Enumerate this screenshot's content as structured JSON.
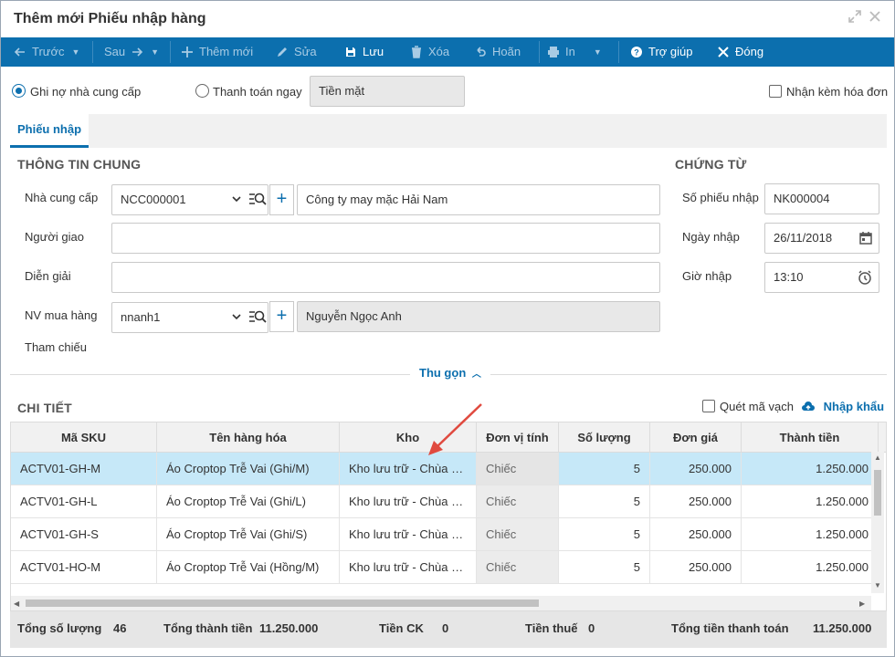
{
  "window": {
    "title": "Thêm mới Phiếu nhập hàng"
  },
  "toolbar": {
    "prev": "Trước",
    "next": "Sau",
    "add": "Thêm mới",
    "edit": "Sửa",
    "save": "Lưu",
    "delete": "Xóa",
    "undo": "Hoãn",
    "print": "In",
    "help": "Trợ giúp",
    "close": "Đóng"
  },
  "payment": {
    "debt_label": "Ghi nợ nhà cung cấp",
    "pay_now_label": "Thanh toán ngay",
    "method_value": "Tiền mặt",
    "invoice_label": "Nhận kèm hóa đơn"
  },
  "tabs": [
    {
      "label": "Phiếu nhập"
    }
  ],
  "general": {
    "heading": "THÔNG TIN CHUNG",
    "supplier_label": "Nhà cung cấp",
    "supplier_code": "NCC000001",
    "supplier_name": "Công ty may mặc Hải Nam",
    "deliverer_label": "Người giao",
    "deliverer_value": "",
    "description_label": "Diễn giải",
    "description_value": "",
    "buyer_label": "NV mua hàng",
    "buyer_code": "nnanh1",
    "buyer_name": "Nguyễn Ngọc Anh",
    "reference_label": "Tham chiếu"
  },
  "voucher": {
    "heading": "CHỨNG TỪ",
    "number_label": "Số phiếu nhập",
    "number_value": "NK000004",
    "date_label": "Ngày nhập",
    "date_value": "26/11/2018",
    "time_label": "Giờ nhập",
    "time_value": "13:10"
  },
  "collapse_label": "Thu gọn",
  "detail": {
    "heading": "CHI TIẾT",
    "barcode_label": "Quét mã vạch",
    "import_label": "Nhập khẩu",
    "columns": [
      "Mã SKU",
      "Tên hàng hóa",
      "Kho",
      "Đơn vị tính",
      "Số lượng",
      "Đơn giá",
      "Thành tiền"
    ],
    "rows": [
      {
        "sku": "ACTV01-GH-M",
        "name": "Áo Croptop Trễ Vai (Ghi/M)",
        "warehouse": "Kho lưu trữ - Chùa Bộc",
        "unit": "Chiếc",
        "qty": "5",
        "price": "250.000",
        "amount": "1.250.000"
      },
      {
        "sku": "ACTV01-GH-L",
        "name": "Áo Croptop Trễ Vai (Ghi/L)",
        "warehouse": "Kho lưu trữ - Chùa Bộc",
        "unit": "Chiếc",
        "qty": "5",
        "price": "250.000",
        "amount": "1.250.000"
      },
      {
        "sku": "ACTV01-GH-S",
        "name": "Áo Croptop Trễ Vai (Ghi/S)",
        "warehouse": "Kho lưu trữ - Chùa Bộc",
        "unit": "Chiếc",
        "qty": "5",
        "price": "250.000",
        "amount": "1.250.000"
      },
      {
        "sku": "ACTV01-HO-M",
        "name": "Áo Croptop Trễ Vai (Hồng/M)",
        "warehouse": "Kho lưu trữ - Chùa Bộc",
        "unit": "Chiếc",
        "qty": "5",
        "price": "250.000",
        "amount": "1.250.000"
      }
    ]
  },
  "footer": {
    "total_qty_label": "Tổng số lượng",
    "total_qty_value": "46",
    "total_amount_label": "Tổng thành tiền",
    "total_amount_value": "11.250.000",
    "discount_label": "Tiền CK",
    "discount_value": "0",
    "tax_label": "Tiền thuế",
    "tax_value": "0",
    "grand_total_label": "Tổng tiền thanh toán",
    "grand_total_value": "11.250.000"
  },
  "colors": {
    "primary": "#0c6fae",
    "selected_row": "#c6e8f8",
    "annotation_arrow": "#e04a3f"
  }
}
